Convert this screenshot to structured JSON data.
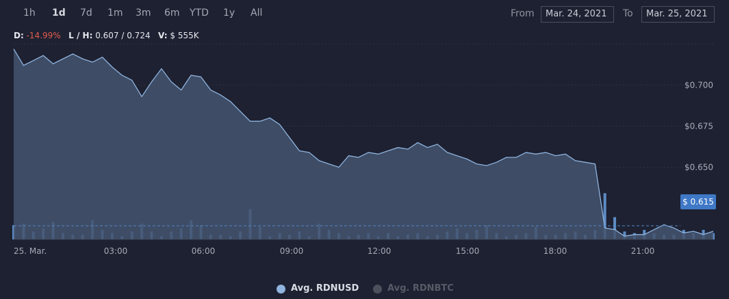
{
  "toolbar": {
    "ranges": [
      "1h",
      "1d",
      "7d",
      "1m",
      "3m",
      "6m",
      "YTD",
      "1y",
      "All"
    ],
    "active_range": "1d",
    "from_label": "From",
    "from_value": "Mar. 24, 2021",
    "to_label": "To",
    "to_value": "Mar. 25, 2021"
  },
  "stats": {
    "d_label": "D:",
    "d_value": "-14.99%",
    "lh_label": "L / H:",
    "lh_value": "0.607 / 0.724",
    "v_label": "V:",
    "v_value": "$ 555K"
  },
  "current_price_label": "$ 0.615",
  "legend": {
    "items": [
      {
        "label": "Avg. RDNUSD",
        "active": true
      },
      {
        "label": "Avg. RDNBTC",
        "active": false
      }
    ]
  },
  "colors": {
    "background": "#1e2131",
    "line": "#8fb4e0",
    "area": "#44536e",
    "volume": "#5d8cc4",
    "negative": "#e25b4d",
    "tag": "#3f78c6"
  },
  "chart_data": {
    "type": "area",
    "series": [
      {
        "name": "Avg. RDNUSD",
        "x": [
          "00:00",
          "00:20",
          "00:40",
          "01:00",
          "01:20",
          "01:40",
          "02:00",
          "02:20",
          "02:40",
          "03:00",
          "03:20",
          "03:40",
          "04:00",
          "04:20",
          "04:40",
          "05:00",
          "05:20",
          "05:40",
          "06:00",
          "06:20",
          "06:40",
          "07:00",
          "07:20",
          "07:40",
          "08:00",
          "08:20",
          "08:40",
          "09:00",
          "09:20",
          "09:40",
          "10:00",
          "10:20",
          "10:40",
          "11:00",
          "11:20",
          "11:40",
          "12:00",
          "12:20",
          "12:40",
          "13:00",
          "13:20",
          "13:40",
          "14:00",
          "14:20",
          "14:40",
          "15:00",
          "15:20",
          "15:40",
          "16:00",
          "16:20",
          "16:40",
          "17:00",
          "17:20",
          "17:40",
          "18:00",
          "18:20",
          "18:40",
          "19:00",
          "19:20",
          "19:40",
          "20:00",
          "20:20",
          "20:40",
          "21:00",
          "21:20",
          "21:40",
          "22:00",
          "22:20",
          "22:40",
          "23:00",
          "23:20",
          "23:40"
        ],
        "values": [
          0.722,
          0.712,
          0.715,
          0.718,
          0.713,
          0.716,
          0.719,
          0.716,
          0.714,
          0.717,
          0.711,
          0.706,
          0.703,
          0.693,
          0.702,
          0.71,
          0.702,
          0.697,
          0.706,
          0.705,
          0.697,
          0.694,
          0.69,
          0.684,
          0.678,
          0.678,
          0.68,
          0.676,
          0.668,
          0.66,
          0.659,
          0.654,
          0.652,
          0.65,
          0.657,
          0.656,
          0.659,
          0.658,
          0.66,
          0.662,
          0.661,
          0.665,
          0.662,
          0.664,
          0.659,
          0.657,
          0.655,
          0.652,
          0.651,
          0.653,
          0.656,
          0.656,
          0.659,
          0.658,
          0.659,
          0.657,
          0.658,
          0.654,
          0.653,
          0.652,
          0.613,
          0.612,
          0.608,
          0.609,
          0.609,
          0.612,
          0.615,
          0.613,
          0.61,
          0.611,
          0.609,
          0.611
        ]
      }
    ],
    "volume": [
      0.09,
      0.1,
      0.05,
      0.07,
      0.11,
      0.04,
      0.03,
      0.03,
      0.12,
      0.06,
      0.04,
      0.02,
      0.05,
      0.1,
      0.05,
      0.02,
      0.05,
      0.07,
      0.12,
      0.09,
      0.03,
      0.03,
      0.02,
      0.05,
      0.19,
      0.08,
      0.02,
      0.04,
      0.03,
      0.05,
      0.02,
      0.1,
      0.06,
      0.04,
      0.02,
      0.03,
      0.04,
      0.02,
      0.04,
      0.02,
      0.03,
      0.04,
      0.02,
      0.03,
      0.05,
      0.07,
      0.04,
      0.06,
      0.09,
      0.04,
      0.02,
      0.03,
      0.04,
      0.08,
      0.03,
      0.03,
      0.04,
      0.05,
      0.03,
      0.06,
      0.29,
      0.14,
      0.05,
      0.04,
      0.06,
      0.04,
      0.03,
      0.03,
      0.06,
      0.04,
      0.06,
      0.04
    ],
    "y_ticks": [
      0.7,
      0.675,
      0.65
    ],
    "y_tick_labels": [
      "$0.700",
      "$0.675",
      "$0.650"
    ],
    "x_tick_labels": [
      "25. Mar.",
      "03:00",
      "06:00",
      "09:00",
      "12:00",
      "15:00",
      "18:00",
      "21:00"
    ],
    "ylim": [
      0.606,
      0.726
    ],
    "last_value": 0.615,
    "grid": true,
    "legend_position": "bottom"
  }
}
